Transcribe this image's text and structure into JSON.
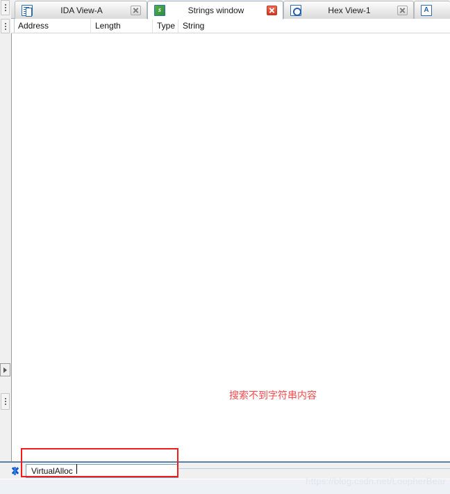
{
  "window": {
    "title": "IDA Strings window"
  },
  "tabs": [
    {
      "label": "IDA View-A",
      "icon": "document-icon",
      "active": false,
      "close_style": "grey"
    },
    {
      "label": "Strings window",
      "icon": "strings-icon",
      "active": true,
      "close_style": "red"
    },
    {
      "label": "Hex View-1",
      "icon": "hex-view-icon",
      "active": false,
      "close_style": "grey"
    },
    {
      "label": "",
      "icon": "imports-icon",
      "active": false,
      "close_style": "none"
    }
  ],
  "columns": [
    {
      "label": "Address"
    },
    {
      "label": "Length"
    },
    {
      "label": "Type"
    },
    {
      "label": "String"
    }
  ],
  "list": {
    "rows": [],
    "empty_message": "搜索不到字符串内容",
    "empty_message_color": "#f24a4a"
  },
  "quick_filter": {
    "icon": "quick-filter-cancel-icon",
    "value": "VirtualAlloc",
    "placeholder": ""
  },
  "annotation": {
    "type": "highlight-rectangle",
    "color": "#ef1c1c"
  },
  "watermark": {
    "text": "https://blog.csdn.net/LoopherBear"
  },
  "rail": {
    "grips": [
      "top-grip",
      "bottom-grip"
    ],
    "splitter": "expand-arrow"
  }
}
